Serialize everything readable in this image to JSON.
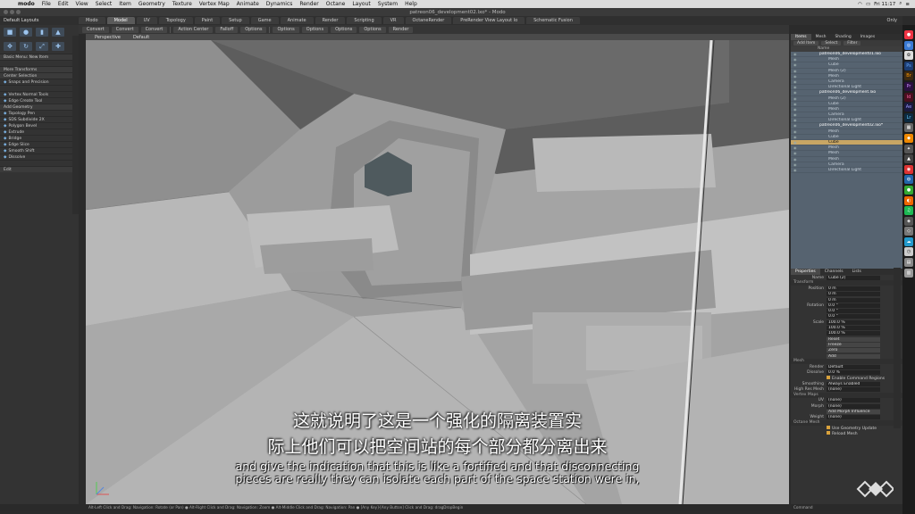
{
  "menubar": {
    "app": "modo",
    "items": [
      "File",
      "Edit",
      "View",
      "Select",
      "Item",
      "Geometry",
      "Texture",
      "Vertex Map",
      "Animate",
      "Dynamics",
      "Render",
      "Octane",
      "Layout",
      "System",
      "Help"
    ],
    "clock": "Fri 11:17"
  },
  "window": {
    "title": "patreon06_development02.lxo* - Modo"
  },
  "layout_bar": {
    "layouts_label": "Default Layouts",
    "tabs": [
      "Modo",
      "Model",
      "UV",
      "Topology",
      "Paint",
      "Setup",
      "Game",
      "Animate",
      "Render",
      "Scripting",
      "VR",
      "OctaneRender",
      "PreRender View Layout lo",
      "Schematic Fusion"
    ],
    "active_tab": "Model",
    "only_label": "Only"
  },
  "toolbar": {
    "items": [
      "Convert",
      "Convert",
      "Convert",
      "Action Center",
      "Falloff",
      "Options",
      "Options",
      "Options",
      "Options",
      "Options",
      "Render"
    ]
  },
  "left_panel": {
    "menu_label": "Basic Menu: New Item",
    "more_transforms": "More Transforms",
    "center_selection": "Center Selection",
    "snaps": "Snaps and Precision",
    "tools": [
      "Vertex Normal Tools",
      "Edge Create Tool",
      "Add Geometry",
      "Topology Pen",
      "SDS Subdivide 2X",
      "Polygon Bevel",
      "Extrude",
      "Bridge",
      "Edge Slice",
      "Smooth Shift",
      "Dissolve"
    ],
    "edit_label": "Edit"
  },
  "viewport": {
    "view_name": "Perspective",
    "shading": "Default"
  },
  "subtitles": {
    "cn_line1": "这就说明了这是一个强化的隔离装置实",
    "cn_line2": "际上他们可以把空间站的每个部分都分离出来",
    "en_line1": "and give the indication that this is like a fortified and that disconnecting",
    "en_line2": "pieces are really they can isolate each part of the space station were in,"
  },
  "statusbar": {
    "hint": "Alt-Left Click and Drag: Navigation: Rotate (or Pan) ● Alt-Right Click and Drag: Navigation: Zoom ● Alt-Middle Click and Drag: Navigation: Pan ● [Any Key]-[Any Button] Click and Drag: dragDropBegin",
    "command": "Command"
  },
  "item_list": {
    "tabs": [
      "Items",
      "Mesh",
      "Shading",
      "Images"
    ],
    "active_tab": "Items",
    "tool_buttons": [
      "Add Item",
      "Select",
      "Filter"
    ],
    "header": "Name",
    "items": [
      {
        "name": "patreon06_development01.lxo",
        "kind": "grp"
      },
      {
        "name": "Mesh",
        "kind": "item"
      },
      {
        "name": "Cube",
        "kind": "item"
      },
      {
        "name": "Mesh (2)",
        "kind": "item"
      },
      {
        "name": "Mesh",
        "kind": "item"
      },
      {
        "name": "Camera",
        "kind": "item"
      },
      {
        "name": "Directional Light",
        "kind": "item"
      },
      {
        "name": "patreon06_development.lxo",
        "kind": "grp"
      },
      {
        "name": "Mesh (2)",
        "kind": "item"
      },
      {
        "name": "Cube",
        "kind": "item"
      },
      {
        "name": "Mesh",
        "kind": "item"
      },
      {
        "name": "Camera",
        "kind": "item"
      },
      {
        "name": "Directional Light",
        "kind": "item"
      },
      {
        "name": "patreon06_development02.lxo*",
        "kind": "grp"
      },
      {
        "name": "Mesh",
        "kind": "item"
      },
      {
        "name": "Cube",
        "kind": "item"
      },
      {
        "name": "Cube",
        "kind": "sel"
      },
      {
        "name": "Mesh",
        "kind": "item"
      },
      {
        "name": "Mesh",
        "kind": "item"
      },
      {
        "name": "Mesh",
        "kind": "item"
      },
      {
        "name": "Camera",
        "kind": "item"
      },
      {
        "name": "Directional Light",
        "kind": "item"
      }
    ]
  },
  "properties": {
    "tabs": [
      "Properties",
      "Channels",
      "Lists"
    ],
    "active_tab": "Properties",
    "name_label": "Name",
    "name_value": "Cube (2)",
    "section_transform": "Transform",
    "position_label": "Position",
    "position": [
      "0 m",
      "0 m",
      "0 m"
    ],
    "rotation_label": "Rotation",
    "rotation": [
      "0.0 °",
      "0.0 °",
      "0.0 °"
    ],
    "scale_label": "Scale",
    "scale": [
      "100.0 %",
      "100.0 %",
      "100.0 %"
    ],
    "buttons": [
      "Reset",
      "Freeze",
      "Zero",
      "Add"
    ],
    "section_mesh": "Mesh",
    "render_label": "Render",
    "render_value": "Default",
    "dissolve_label": "Dissolve",
    "dissolve_value": "0.0 %",
    "enable_cmd": "Enable Command Regions",
    "smoothing_label": "Smoothing",
    "smoothing_value": "Always Enabled",
    "highres_label": "High Res Mesh",
    "highres_value": "(none)",
    "section_vmaps": "Vertex Maps",
    "uv_label": "UV",
    "uv_value": "(none)",
    "morph_label": "Morph",
    "morph_value": "(none)",
    "add_morph": "Add Morph Influence",
    "weight_label": "Weight",
    "weight_value": "(none)",
    "section_octane": "Octane Mesh",
    "use_geo": "Use Geometry Update",
    "reload": "Reload Mesh"
  },
  "colors": {
    "viewport_bg": "#9a9a9a",
    "selection": "#c8a664",
    "accent": "#d9a23c"
  }
}
